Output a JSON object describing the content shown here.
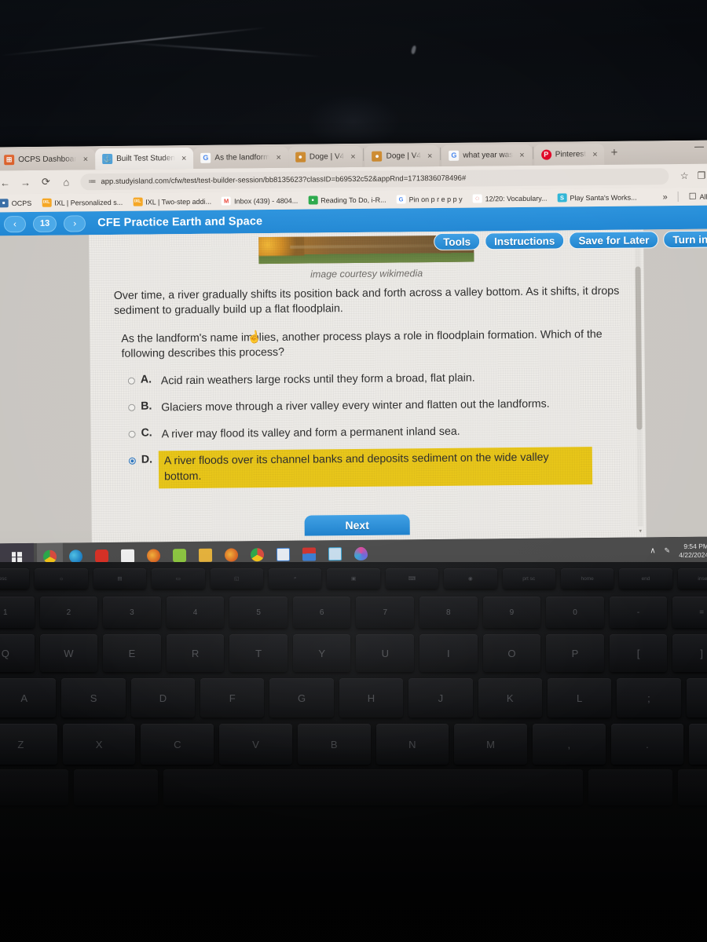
{
  "browser": {
    "tabs": [
      {
        "title": "OCPS Dashboar",
        "favicon_name": "ocps-icon",
        "favicon_color": "#e2622a",
        "favicon_glyph": "⊞",
        "active": false
      },
      {
        "title": "Built Test Studen",
        "favicon_name": "study-island-icon",
        "favicon_color": "#4da3dd",
        "favicon_glyph": "⚓",
        "active": true
      },
      {
        "title": "As the landform",
        "favicon_name": "google-icon",
        "favicon_color": "#ffffff",
        "favicon_glyph": "G",
        "active": false
      },
      {
        "title": "Doge | V4",
        "favicon_name": "doge-icon",
        "favicon_color": "#d08a2a",
        "favicon_glyph": "●",
        "active": false
      },
      {
        "title": "Doge | V4",
        "favicon_name": "doge-icon",
        "favicon_color": "#d08a2a",
        "favicon_glyph": "●",
        "active": false
      },
      {
        "title": "what year was ",
        "favicon_name": "google-icon",
        "favicon_color": "#ffffff",
        "favicon_glyph": "G",
        "active": false
      },
      {
        "title": "Pinterest",
        "favicon_name": "pinterest-icon",
        "favicon_color": "#e60023",
        "favicon_glyph": "P",
        "active": false
      }
    ],
    "tab_close_glyph": "×",
    "new_tab_glyph": "+",
    "nav": {
      "back_glyph": "←",
      "forward_glyph": "→",
      "reload_glyph": "⟳",
      "home_glyph": "⌂"
    },
    "url": "app.studyisland.com/cfw/test/test-builder-session/bb8135623?classID=b69532c52&appRnd=1713836078496#",
    "site_settings_glyph": "≔",
    "star_glyph": "☆",
    "sidepanel_glyph": "❐",
    "bookmarks": [
      {
        "label": "OCPS",
        "icon_name": "ocps-bookmark-icon",
        "color": "#3a6ea5",
        "glyph": "■"
      },
      {
        "label": "IXL | Personalized s...",
        "icon_name": "ixl-icon",
        "color": "#f5a623",
        "glyph": "IXL"
      },
      {
        "label": "IXL | Two-step addi...",
        "icon_name": "ixl-icon",
        "color": "#f5a623",
        "glyph": "IXL"
      },
      {
        "label": "Inbox (439) - 4804...",
        "icon_name": "gmail-icon",
        "color": "#ea4335",
        "glyph": "M"
      },
      {
        "label": "Reading To Do, i-R...",
        "icon_name": "reading-icon",
        "color": "#2aa84a",
        "glyph": "●"
      },
      {
        "label": "Pin on p r e p p y",
        "icon_name": "google-icon",
        "color": "#ffffff",
        "glyph": "G"
      },
      {
        "label": "12/20: Vocabulary...",
        "icon_name": "vocabulary-icon",
        "color": "#ffffff",
        "glyph": "◌"
      },
      {
        "label": "Play Santa's Works...",
        "icon_name": "santa-icon",
        "color": "#2fb5d6",
        "glyph": "S"
      }
    ],
    "bookmarks_overflow_glyph": "»",
    "all_bookmarks_label": "All",
    "all_bookmarks_icon_glyph": "☐",
    "minimize_label": ""
  },
  "test": {
    "question_number": "13",
    "prev_glyph": "‹",
    "next_glyph": "›",
    "title": "CFE Practice Earth and Space",
    "actions": [
      {
        "label": "Tools",
        "name": "tools-button"
      },
      {
        "label": "Instructions",
        "name": "instructions-button"
      },
      {
        "label": "Save for Later",
        "name": "save-for-later-button"
      },
      {
        "label": "Turn in",
        "name": "turn-in-button"
      }
    ],
    "image_credit": "image courtesy wikimedia",
    "passage_1": "Over time, a river gradually shifts its position back and forth across a valley bottom. As it shifts, it drops sediment to gradually build up a flat floodplain.",
    "passage_2": "As the landform's name implies, another process plays a role in floodplain formation. Which of the following describes this process?",
    "choices": [
      {
        "letter": "A.",
        "text": "Acid rain weathers large rocks until they form a broad, flat plain.",
        "selected": false
      },
      {
        "letter": "B.",
        "text": "Glaciers move through a river valley every winter and flatten out the landforms.",
        "selected": false
      },
      {
        "letter": "C.",
        "text": "A river may flood its valley and form a permanent inland sea.",
        "selected": false
      },
      {
        "letter": "D.",
        "text": "A river floods over its channel banks and deposits sediment on the wide valley bottom.",
        "selected": true
      }
    ],
    "next_label": "Next",
    "cursor_glyph": "☝",
    "scroll_down_glyph": "▾",
    "highlight_color": "#e8c515",
    "accent_color": "#2b93dd"
  },
  "taskbar": {
    "start_name": "windows-start-button",
    "items": [
      {
        "name": "chrome-taskbar-icon",
        "color": "#d94a3d",
        "running": true,
        "active": true
      },
      {
        "name": "edge-taskbar-icon",
        "color": "#2d8fd0",
        "running": false,
        "active": false
      },
      {
        "name": "youtube-taskbar-icon",
        "color": "#d93025",
        "running": false,
        "active": false
      },
      {
        "name": "sway-taskbar-icon",
        "color": "#f2f2f2",
        "running": false,
        "active": false
      },
      {
        "name": "firefox-taskbar-icon",
        "color": "#e06a1f",
        "running": false,
        "active": false
      },
      {
        "name": "zoom-taskbar-icon",
        "color": "#8cc63f",
        "running": false,
        "active": false
      },
      {
        "name": "explorer-taskbar-icon",
        "color": "#e8b33a",
        "running": false,
        "active": false
      },
      {
        "name": "firefox2-taskbar-icon",
        "color": "#e06a1f",
        "running": false,
        "active": false
      },
      {
        "name": "chrome2-taskbar-icon",
        "color": "#d94a3d",
        "running": true,
        "active": false
      },
      {
        "name": "word-taskbar-icon",
        "color": "#3a7fd5",
        "running": true,
        "active": false
      },
      {
        "name": "adobe-taskbar-icon",
        "color": "#d0332e",
        "running": true,
        "active": false
      },
      {
        "name": "calculator-taskbar-icon",
        "color": "#3ba7d9",
        "running": true,
        "active": false
      },
      {
        "name": "paint-taskbar-icon",
        "color": "#b04fd0",
        "running": true,
        "active": false
      }
    ],
    "tray": {
      "chevron_glyph": "∧",
      "pen_glyph": "✎",
      "time": "9:54 PM",
      "date": "4/22/2024"
    }
  },
  "keyboard": {
    "row_fn": [
      "esc",
      "☼",
      "▤",
      "▭",
      "◱",
      "⌕",
      "▣",
      "⌨",
      "◉",
      "prt sc",
      "home",
      "end",
      "insert"
    ],
    "row_num": [
      "1",
      "2",
      "3",
      "4",
      "5",
      "6",
      "7",
      "8",
      "9",
      "0",
      "-",
      "="
    ],
    "row_q": [
      "Q",
      "W",
      "E",
      "R",
      "T",
      "Y",
      "U",
      "I",
      "O",
      "P",
      "[",
      "]"
    ],
    "row_a": [
      "A",
      "S",
      "D",
      "F",
      "G",
      "H",
      "J",
      "K",
      "L",
      ";",
      "'"
    ],
    "row_z": [
      "Z",
      "X",
      "C",
      "V",
      "B",
      "N",
      "M",
      ",",
      ".",
      "/"
    ]
  }
}
